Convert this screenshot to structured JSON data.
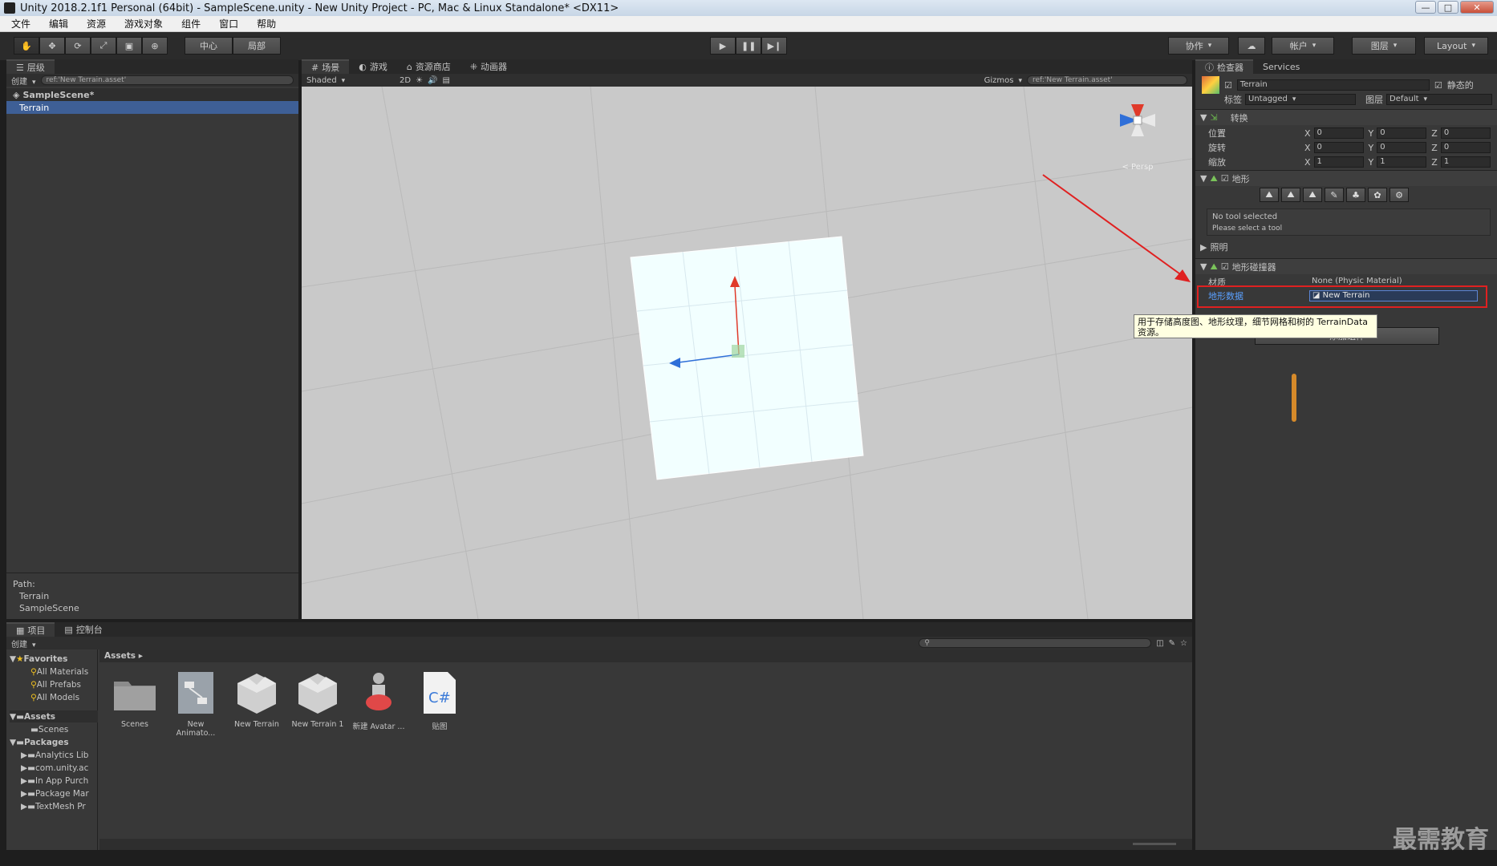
{
  "window": {
    "title": "Unity 2018.2.1f1 Personal (64bit) - SampleScene.unity - New Unity Project - PC, Mac & Linux Standalone* <DX11>"
  },
  "menu": [
    "文件",
    "编辑",
    "资源",
    "游戏对象",
    "组件",
    "窗口",
    "帮助"
  ],
  "toolbar": {
    "pivot": "中心",
    "space": "局部",
    "collab": "协作",
    "account": "帐户",
    "layers": "图层",
    "layout": "Layout"
  },
  "hierarchy": {
    "tab": "层级",
    "create": "创建",
    "search": "ref:'New Terrain.asset'",
    "scene": "SampleScene*",
    "item": "Terrain",
    "path_label": "Path:",
    "path": [
      "Terrain",
      "SampleScene"
    ]
  },
  "scene": {
    "tabs": [
      "场景",
      "游戏",
      "资源商店",
      "动画器"
    ],
    "shading": "Shaded",
    "mode2d": "2D",
    "gizmos": "Gizmos",
    "search": "ref:'New Terrain.asset'",
    "persp": "< Persp"
  },
  "inspector": {
    "tabs": [
      "检查器",
      "Services"
    ],
    "object_name": "Terrain",
    "static_label": "静态的",
    "tag_label": "标签",
    "tag_value": "Untagged",
    "layer_label": "图层",
    "layer_value": "Default",
    "transform": {
      "title": "转换",
      "rows": [
        {
          "label": "位置",
          "x": "0",
          "y": "0",
          "z": "0"
        },
        {
          "label": "旋转",
          "x": "0",
          "y": "0",
          "z": "0"
        },
        {
          "label": "缩放",
          "x": "1",
          "y": "1",
          "z": "1"
        }
      ]
    },
    "terrain": {
      "title": "地形",
      "no_tool": "No tool selected",
      "please_select": "Please select a tool"
    },
    "lighting": "照明",
    "collider": {
      "title": "地形碰撞器",
      "material_label": "材质",
      "material_value": "None (Physic Material)",
      "data_label": "地形数据",
      "data_value": "New Terrain"
    },
    "tooltip": "用于存储高度图、地形纹理，细节网格和树的 TerrainData 资源。",
    "add_component": "添加组件"
  },
  "project": {
    "tabs": [
      "项目",
      "控制台"
    ],
    "create": "创建",
    "favorites": "Favorites",
    "fav_items": [
      "All Materials",
      "All Prefabs",
      "All Models"
    ],
    "assets_root": "Assets",
    "assets_children": [
      "Scenes"
    ],
    "packages_root": "Packages",
    "packages_children": [
      "Analytics Lib",
      "com.unity.ac",
      "In App Purch",
      "Package Mar",
      "TextMesh Pr"
    ],
    "breadcrumb": "Assets",
    "assets": [
      {
        "name": "Scenes",
        "icon": "folder-icon"
      },
      {
        "name": "New Animato...",
        "icon": "animator-icon"
      },
      {
        "name": "New Terrain",
        "icon": "terrain-asset-icon"
      },
      {
        "name": "New Terrain 1",
        "icon": "terrain-asset-icon"
      },
      {
        "name": "新建 Avatar ...",
        "icon": "avatar-icon"
      },
      {
        "name": "贴图",
        "icon": "csharp-script-icon"
      }
    ]
  },
  "watermark": "最需教育",
  "colors": {
    "accent_blue": "#3e5f96",
    "annotation_red": "#e02020",
    "tooltip_bg": "#ffffe1"
  }
}
